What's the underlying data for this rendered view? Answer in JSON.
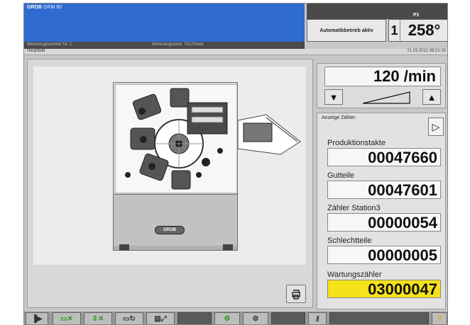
{
  "header": {
    "brand": "GROB",
    "brand_sub": "GRM 80",
    "program_info": "Werkzeugnummer Nr. 1",
    "tool_info": "Werkzeugname: 7012Serie",
    "status": "Automatikbetrieb aktiv",
    "position_label": "P1",
    "position_number": "1",
    "angle": "258°"
  },
  "title_bar": {
    "page": "Hauptbild",
    "datetime": "21.03.2011  08:21:26"
  },
  "machine": {
    "logo_text": "GROB",
    "action_icon": "print-icon"
  },
  "speed": {
    "value": "120 /min",
    "decrease_icon": "triangle-down-icon",
    "increase_icon": "triangle-up-icon"
  },
  "counters": {
    "header": "Anzeige Zähler:",
    "next_icon": "triangle-right-icon",
    "items": [
      {
        "label": "Produktionstakte",
        "value": "00047660"
      },
      {
        "label": "Gutteile",
        "value": "00047601"
      },
      {
        "label": "Zähler Station3",
        "value": "00000054"
      },
      {
        "label": "Schlechtteile",
        "value": "00000005"
      },
      {
        "label": "Wartungszähler",
        "value": "03000047",
        "highlight": "#f5e21a"
      }
    ]
  },
  "toolbar": {
    "buttons": [
      {
        "icon": "play-bar-icon"
      },
      {
        "icon": "feed-icon"
      },
      {
        "icon": "clamp-icon"
      },
      {
        "icon": "tool-change-icon"
      },
      {
        "icon": "image-icon"
      },
      {
        "icon": "blank"
      },
      {
        "icon": "gear-green-icon"
      },
      {
        "icon": "gear-icon"
      },
      {
        "icon": "blank"
      },
      {
        "icon": "key-icon"
      },
      {
        "icon": "blank"
      },
      {
        "icon": "help-icon"
      }
    ]
  },
  "colors": {
    "header_blue": "#2f6ad0",
    "counter_highlight": "#f5e21a",
    "toolbar_green": "#2a9a1a"
  }
}
